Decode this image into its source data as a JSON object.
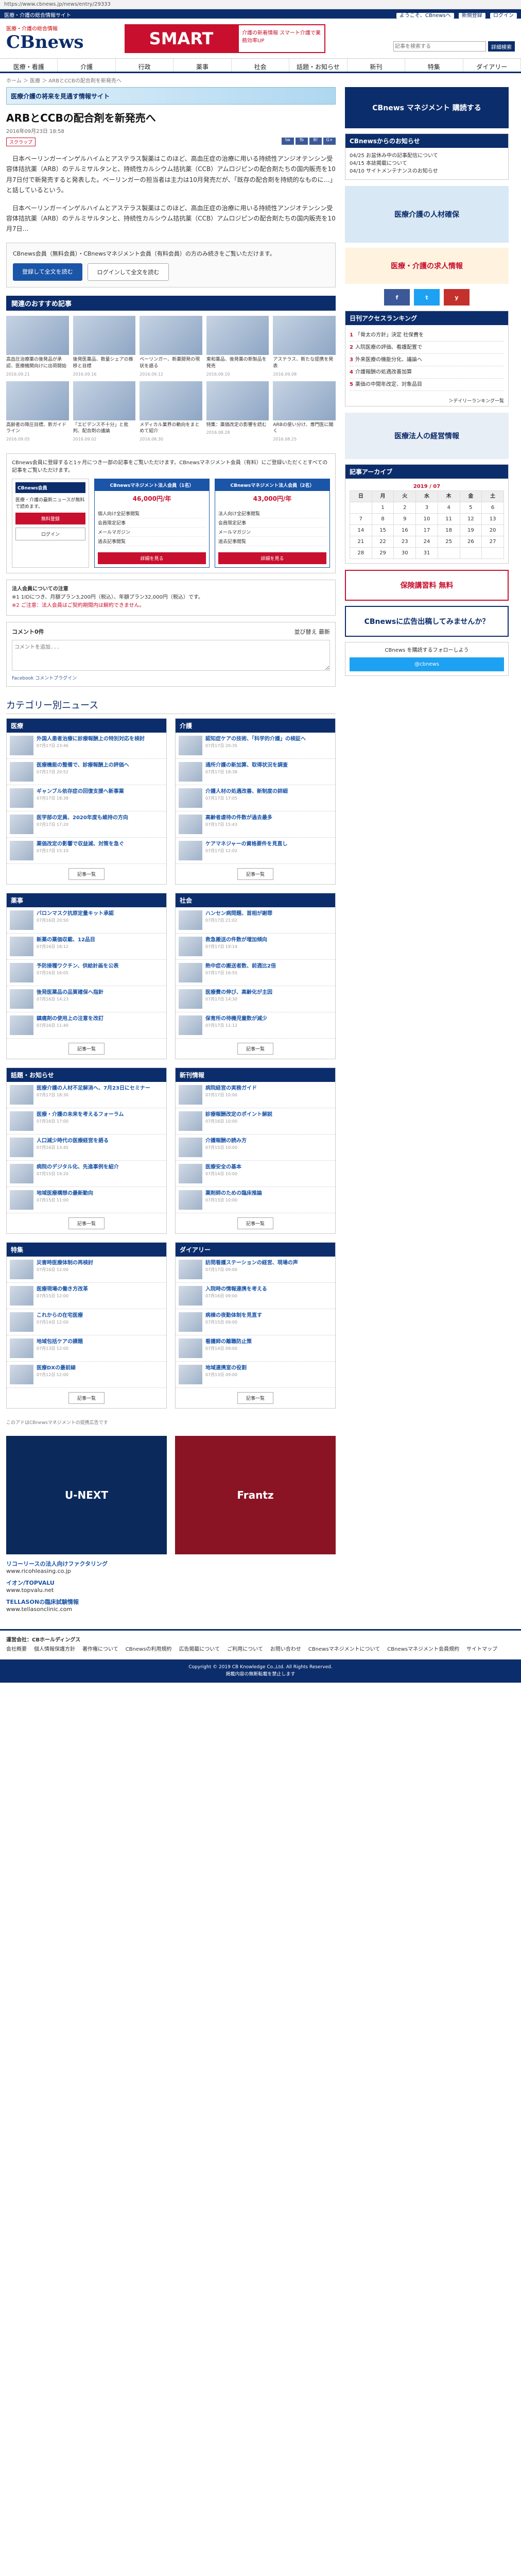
{
  "browser": {
    "url": "https://www.cbnews.jp/news/entry/29333"
  },
  "topstrip": {
    "left": "医療・介護の総合情報サイト",
    "login_links": [
      "ようこそ、CBnewsへ",
      "新規登録",
      "ログイン"
    ]
  },
  "header": {
    "logo": "CBnews",
    "tagline": "医療・介護の総合情報",
    "smart": "SMART",
    "smart_sub": "介護の新着情報 スマート介護で業務効率UP",
    "search_placeholder": "記事を検索する",
    "search_button": "詳細検索"
  },
  "nav": [
    "医療・看護",
    "介護",
    "行政",
    "薬事",
    "社会",
    "話題・お知らせ",
    "新刊",
    "特集",
    "ダイアリー"
  ],
  "breadcrumb": "ホーム ＞ 医療 ＞ ARBとCCBの配合剤を新発売へ",
  "banner": "医療介護の将来を見通す情報サイト",
  "article": {
    "title": "ARBとCCBの配合剤を新発売へ",
    "date": "2016年09月23日 18:58",
    "tag": "スクラップ",
    "share": [
      "tw",
      "fb",
      "B!",
      "G+"
    ],
    "paragraphs": [
      "日本ベーリンガーインゲルハイムとアステラス製薬はこのほど、高血圧症の治療に用いる持続性アンジオテンシン受容体拮抗薬（ARB）のテルミサルタンと、持続性カルシウム拮抗薬（CCB）アムロジピンの配合剤たちの国内販売を10月7日付で新発売すると発表した。ベーリンガーの担当者は主力は10月発売だが、「既存の配合剤を持続的なものに…」と話しているという。",
      "日本ベーリンガーインゲルハイムとアステラス製薬はこのほど、高血圧症の治療に用いる持続性アンジオテンシン受容体拮抗薬（ARB）のテルミサルタンと、持続性カルシウム拮抗薬（CCB）アムロジピンの配合剤たちの国内販売を10月7日…"
    ],
    "callout": "CBnews会員（無料会員）・CBnewsマネジメント会員（有料会員）の方のみ続きをご覧いただけます。",
    "register_btn": "登録して全文を読む",
    "login_btn": "ログインして全文を読む"
  },
  "recommend": {
    "title": "関連のおすすめ記事",
    "items": [
      {
        "t": "高血圧治療薬の後発品が承認、医療機関向けに出荷開始",
        "d": "2016.09.21"
      },
      {
        "t": "後発医薬品、数量シェアの推移と目標",
        "d": "2016.09.16"
      },
      {
        "t": "ベーリンガー、新薬開発の現状を語る",
        "d": "2016.09.12"
      },
      {
        "t": "東和薬品、後発薬の新製品を発売",
        "d": "2016.09.10"
      },
      {
        "t": "アステラス、新たな提携を発表",
        "d": "2016.09.08"
      },
      {
        "t": "高齢者の降圧目標、新ガイドライン",
        "d": "2016.09.05"
      },
      {
        "t": "「エビデンス不十分」と批判、配合剤の議論",
        "d": "2016.09.02"
      },
      {
        "t": "メディカル業界の動向をまとめて紹介",
        "d": "2016.08.30"
      },
      {
        "t": "特集：薬価改定の影響を読む",
        "d": "2016.08.28"
      },
      {
        "t": "ARBの使い分け、専門医に聞く",
        "d": "2016.08.25"
      }
    ]
  },
  "plans": {
    "intro": "CBnews会員に登録すると1ヶ月につき一部の記事をご覧いただけます。CBnewsマネジメント会員（有料）にご登録いただくとすべての記事をご覧いただけます。",
    "left_title": "CBnews会員",
    "left_text": "医療・介護の最新ニュースが無料で読めます。",
    "left_btn": "無料登録",
    "left_login": "ログイン",
    "boxes": [
      {
        "head": "CBnewsマネジメント法人会員（1名）",
        "price": "46,000円/年",
        "btn": "詳細を見る",
        "items": [
          "個人向け全記事閲覧",
          "会員限定記事",
          "メールマガジン",
          "過去記事閲覧"
        ]
      },
      {
        "head": "CBnewsマネジメント法人会員（2名）",
        "price": "43,000円/年",
        "btn": "詳細を見る",
        "items": [
          "法人向け全記事閲覧",
          "会員限定記事",
          "メールマガジン",
          "過去記事閲覧"
        ]
      }
    ]
  },
  "note": {
    "title": "法人会員についての注意",
    "text": "※1 1IDにつき、月額プラン3,200円（税込）、年額プラン32,000円（税込）です。",
    "warn": "※2 ご注意：法人会員はご契約期間内は解約できません。"
  },
  "comments": {
    "count": "コメント0件",
    "sort": "並び替え 最新",
    "placeholder": "コメントを追加...",
    "plugin": "Facebook コメントプラグイン"
  },
  "categories": {
    "title": "カテゴリー別ニュース",
    "boxes": [
      {
        "name": "医療",
        "items": [
          {
            "t": "外国人患者治療に診療報酬上の特別対応を検討",
            "d": "07月17日 23:46"
          },
          {
            "t": "医療機能の整備で、診療報酬上の評価へ",
            "d": "07月17日 20:52"
          },
          {
            "t": "ギャンブル依存症の回復支援へ新事業",
            "d": "07月17日 18:38"
          },
          {
            "t": "医学部の定員、2020年度も維持の方向",
            "d": "07月17日 17:20"
          },
          {
            "t": "薬価改定の影響で収益減、対策を急ぐ",
            "d": "07月17日 15:10"
          }
        ]
      },
      {
        "name": "介護",
        "items": [
          {
            "t": "認知症ケアの技術、「科学的介護」の検証へ",
            "d": "07月17日 20:35"
          },
          {
            "t": "通所介護の新加算、取得状況を調査",
            "d": "07月17日 18:38"
          },
          {
            "t": "介護人材の処遇改善、新制度の詳細",
            "d": "07月17日 17:05"
          },
          {
            "t": "高齢者虐待の件数が過去最多",
            "d": "07月17日 15:43"
          },
          {
            "t": "ケアマネジャーの資格要件を見直し",
            "d": "07月17日 12:02"
          }
        ]
      },
      {
        "name": "薬事",
        "items": [
          {
            "t": "バロンマスク抗原定量キット承認",
            "d": "07月16日 20:50"
          },
          {
            "t": "新薬の薬価収載、12品目",
            "d": "07月16日 18:12"
          },
          {
            "t": "予防接種ワクチン、供給計画を公表",
            "d": "07月16日 16:05"
          },
          {
            "t": "後発医薬品の品質確保へ指針",
            "d": "07月16日 14:23"
          },
          {
            "t": "鎮痛剤の使用上の注意を改訂",
            "d": "07月16日 11:40"
          }
        ]
      },
      {
        "name": "社会",
        "items": [
          {
            "t": "ハンセン病問題、首相が謝罪",
            "d": "07月17日 21:02"
          },
          {
            "t": "救急搬送の件数が増加傾向",
            "d": "07月17日 19:14"
          },
          {
            "t": "熱中症の搬送者数、前週比2倍",
            "d": "07月17日 16:55"
          },
          {
            "t": "医療費の伸び、高齢化が主因",
            "d": "07月17日 14:30"
          },
          {
            "t": "保育所の待機児童数が減少",
            "d": "07月17日 11:12"
          }
        ]
      },
      {
        "name": "話題・お知らせ",
        "items": [
          {
            "t": "医療介護の人材不足解消へ、7月23日にセミナー",
            "d": "07月17日 18:30"
          },
          {
            "t": "医療・介護の未来を考えるフォーラム",
            "d": "07月16日 17:00"
          },
          {
            "t": "人口減少時代の医療経営を語る",
            "d": "07月16日 13:45"
          },
          {
            "t": "病院のデジタル化、先進事例を紹介",
            "d": "07月15日 19:20"
          },
          {
            "t": "地域医療構想の最新動向",
            "d": "07月15日 11:00"
          }
        ]
      },
      {
        "name": "新刊情報",
        "items": [
          {
            "t": "病院経営の実務ガイド",
            "d": "07月17日 10:00"
          },
          {
            "t": "診療報酬改定のポイント解説",
            "d": "07月16日 10:00"
          },
          {
            "t": "介護報酬の読み方",
            "d": "07月15日 10:00"
          },
          {
            "t": "医療安全の基本",
            "d": "07月14日 10:00"
          },
          {
            "t": "薬剤師のための臨床推論",
            "d": "07月13日 10:00"
          }
        ]
      },
      {
        "name": "特集",
        "items": [
          {
            "t": "災害時医療体制の再検討",
            "d": "07月16日 12:00"
          },
          {
            "t": "医療現場の働き方改革",
            "d": "07月15日 12:00"
          },
          {
            "t": "これからの在宅医療",
            "d": "07月14日 12:00"
          },
          {
            "t": "地域包括ケアの課題",
            "d": "07月13日 12:00"
          },
          {
            "t": "医療DXの最前線",
            "d": "07月12日 12:00"
          }
        ]
      },
      {
        "name": "ダイアリー",
        "items": [
          {
            "t": "訪問看護ステーションの経営、現場の声",
            "d": "07月17日 09:00"
          },
          {
            "t": "入院時の情報連携を考える",
            "d": "07月16日 09:00"
          },
          {
            "t": "病棟の夜勤体制を見直す",
            "d": "07月15日 09:00"
          },
          {
            "t": "看護師の離職防止策",
            "d": "07月14日 09:00"
          },
          {
            "t": "地域連携室の役割",
            "d": "07月13日 09:00"
          }
        ]
      }
    ],
    "more": "記事一覧"
  },
  "bottom_ad_note": "このアドはCBnewsマネジメントの提携広告です",
  "ads": [
    {
      "label": "U-NEXT",
      "bg": "#0b2a5b"
    },
    {
      "label": "Frantz",
      "bg": "#8a1424"
    }
  ],
  "textads": [
    {
      "t": "リコーリースの法人向けファクタリング",
      "s": "www.ricohleasing.co.jp"
    },
    {
      "t": "イオン/TOPVALU",
      "s": "www.topvalu.net"
    },
    {
      "t": "TELLASONの臨床試験情報",
      "s": "www.tellasonclinic.com"
    }
  ],
  "side": {
    "top_banner": "CBnews マネジメント 購読する",
    "news_title": "CBnewsからのお知らせ",
    "news": [
      "04/25 お盆休み中の記事配信について",
      "04/15 本誌掲載について",
      "04/10 サイトメンテナンスのお知らせ"
    ],
    "ad2": "医療介護の人材確保",
    "ad3": "医療・介護の求人情報",
    "social": [
      "f",
      "t",
      "y"
    ],
    "rank_title": "日刊アクセスランキング",
    "rank": [
      "「骨太の方針」決定 社保費を",
      "入院医療の評価、看護配置で",
      "外来医療の機能分化、議論へ",
      "介護報酬の処遇改善加算",
      "薬価の中間年改定、対象品目"
    ],
    "rank_more": "＞デイリーランキング一覧",
    "cal_title": "記事アーカイブ",
    "cal_month": "2019 / 07",
    "cal_head": [
      "日",
      "月",
      "火",
      "水",
      "木",
      "金",
      "土"
    ],
    "cal_rows": [
      [
        "",
        "1",
        "2",
        "3",
        "4",
        "5",
        "6"
      ],
      [
        "7",
        "8",
        "9",
        "10",
        "11",
        "12",
        "13"
      ],
      [
        "14",
        "15",
        "16",
        "17",
        "18",
        "19",
        "20"
      ],
      [
        "21",
        "22",
        "23",
        "24",
        "25",
        "26",
        "27"
      ],
      [
        "28",
        "29",
        "30",
        "31",
        "",
        "",
        ""
      ]
    ],
    "ad4": "保険講習料 無料",
    "ad5": "CBnewsに広告出稿してみませんか？",
    "ad6": "医療法人の経営情報",
    "twitter": "CBnews を購読するフォローしよう",
    "twitter_btn": "@cbnews"
  },
  "footer": {
    "company": "運営会社：CBホールディングス",
    "links": [
      "会社概要",
      "個人情報保護方針",
      "著作権について",
      "CBnewsの利用規約",
      "広告掲載について",
      "ご利用について",
      "お問い合わせ",
      "CBnewsマネジメントについて",
      "CBnewsマネジメント会員規約",
      "サイトマップ"
    ],
    "copyright": "Copyright © 2019 CB Knowledge Co.,Ltd. All Rights Reserved.",
    "small": "掲載内容の無断転載を禁止します"
  }
}
